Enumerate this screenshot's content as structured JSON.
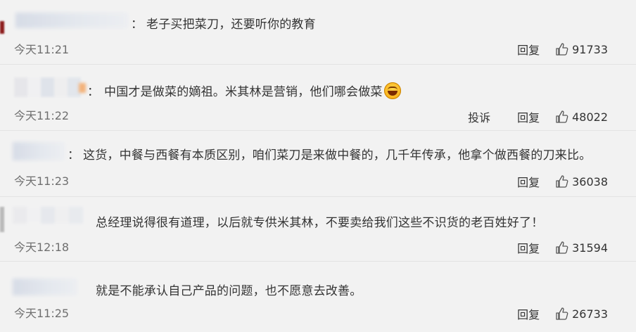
{
  "comments": [
    {
      "text": "老子买把菜刀，还要听你的教育",
      "time": "今天11:21",
      "report": "",
      "reply": "回复",
      "likes": "91733"
    },
    {
      "text": "中国才是做菜的嫡祖。米其林是营销，他们哪会做菜",
      "time": "今天11:22",
      "report": "投诉",
      "reply": "回复",
      "likes": "48022"
    },
    {
      "text": "这货，中餐与西餐有本质区别，咱们菜刀是来做中餐的，几千年传承，他拿个做西餐的刀来比。",
      "time": "今天11:23",
      "report": "",
      "reply": "回复",
      "likes": "36038"
    },
    {
      "text": "总经理说得很有道理，以后就专供米其林，不要卖给我们这些不识货的老百姓好了！",
      "time": "今天12:18",
      "report": "",
      "reply": "回复",
      "likes": "31594"
    },
    {
      "text": "就是不能承认自己产品的问题，也不愿意去改善。",
      "time": "今天11:25",
      "report": "",
      "reply": "回复",
      "likes": "26733"
    }
  ],
  "colon": "：",
  "icons": {
    "like": "thumbs-up-icon",
    "emoji": "laughing-emoji-icon"
  }
}
